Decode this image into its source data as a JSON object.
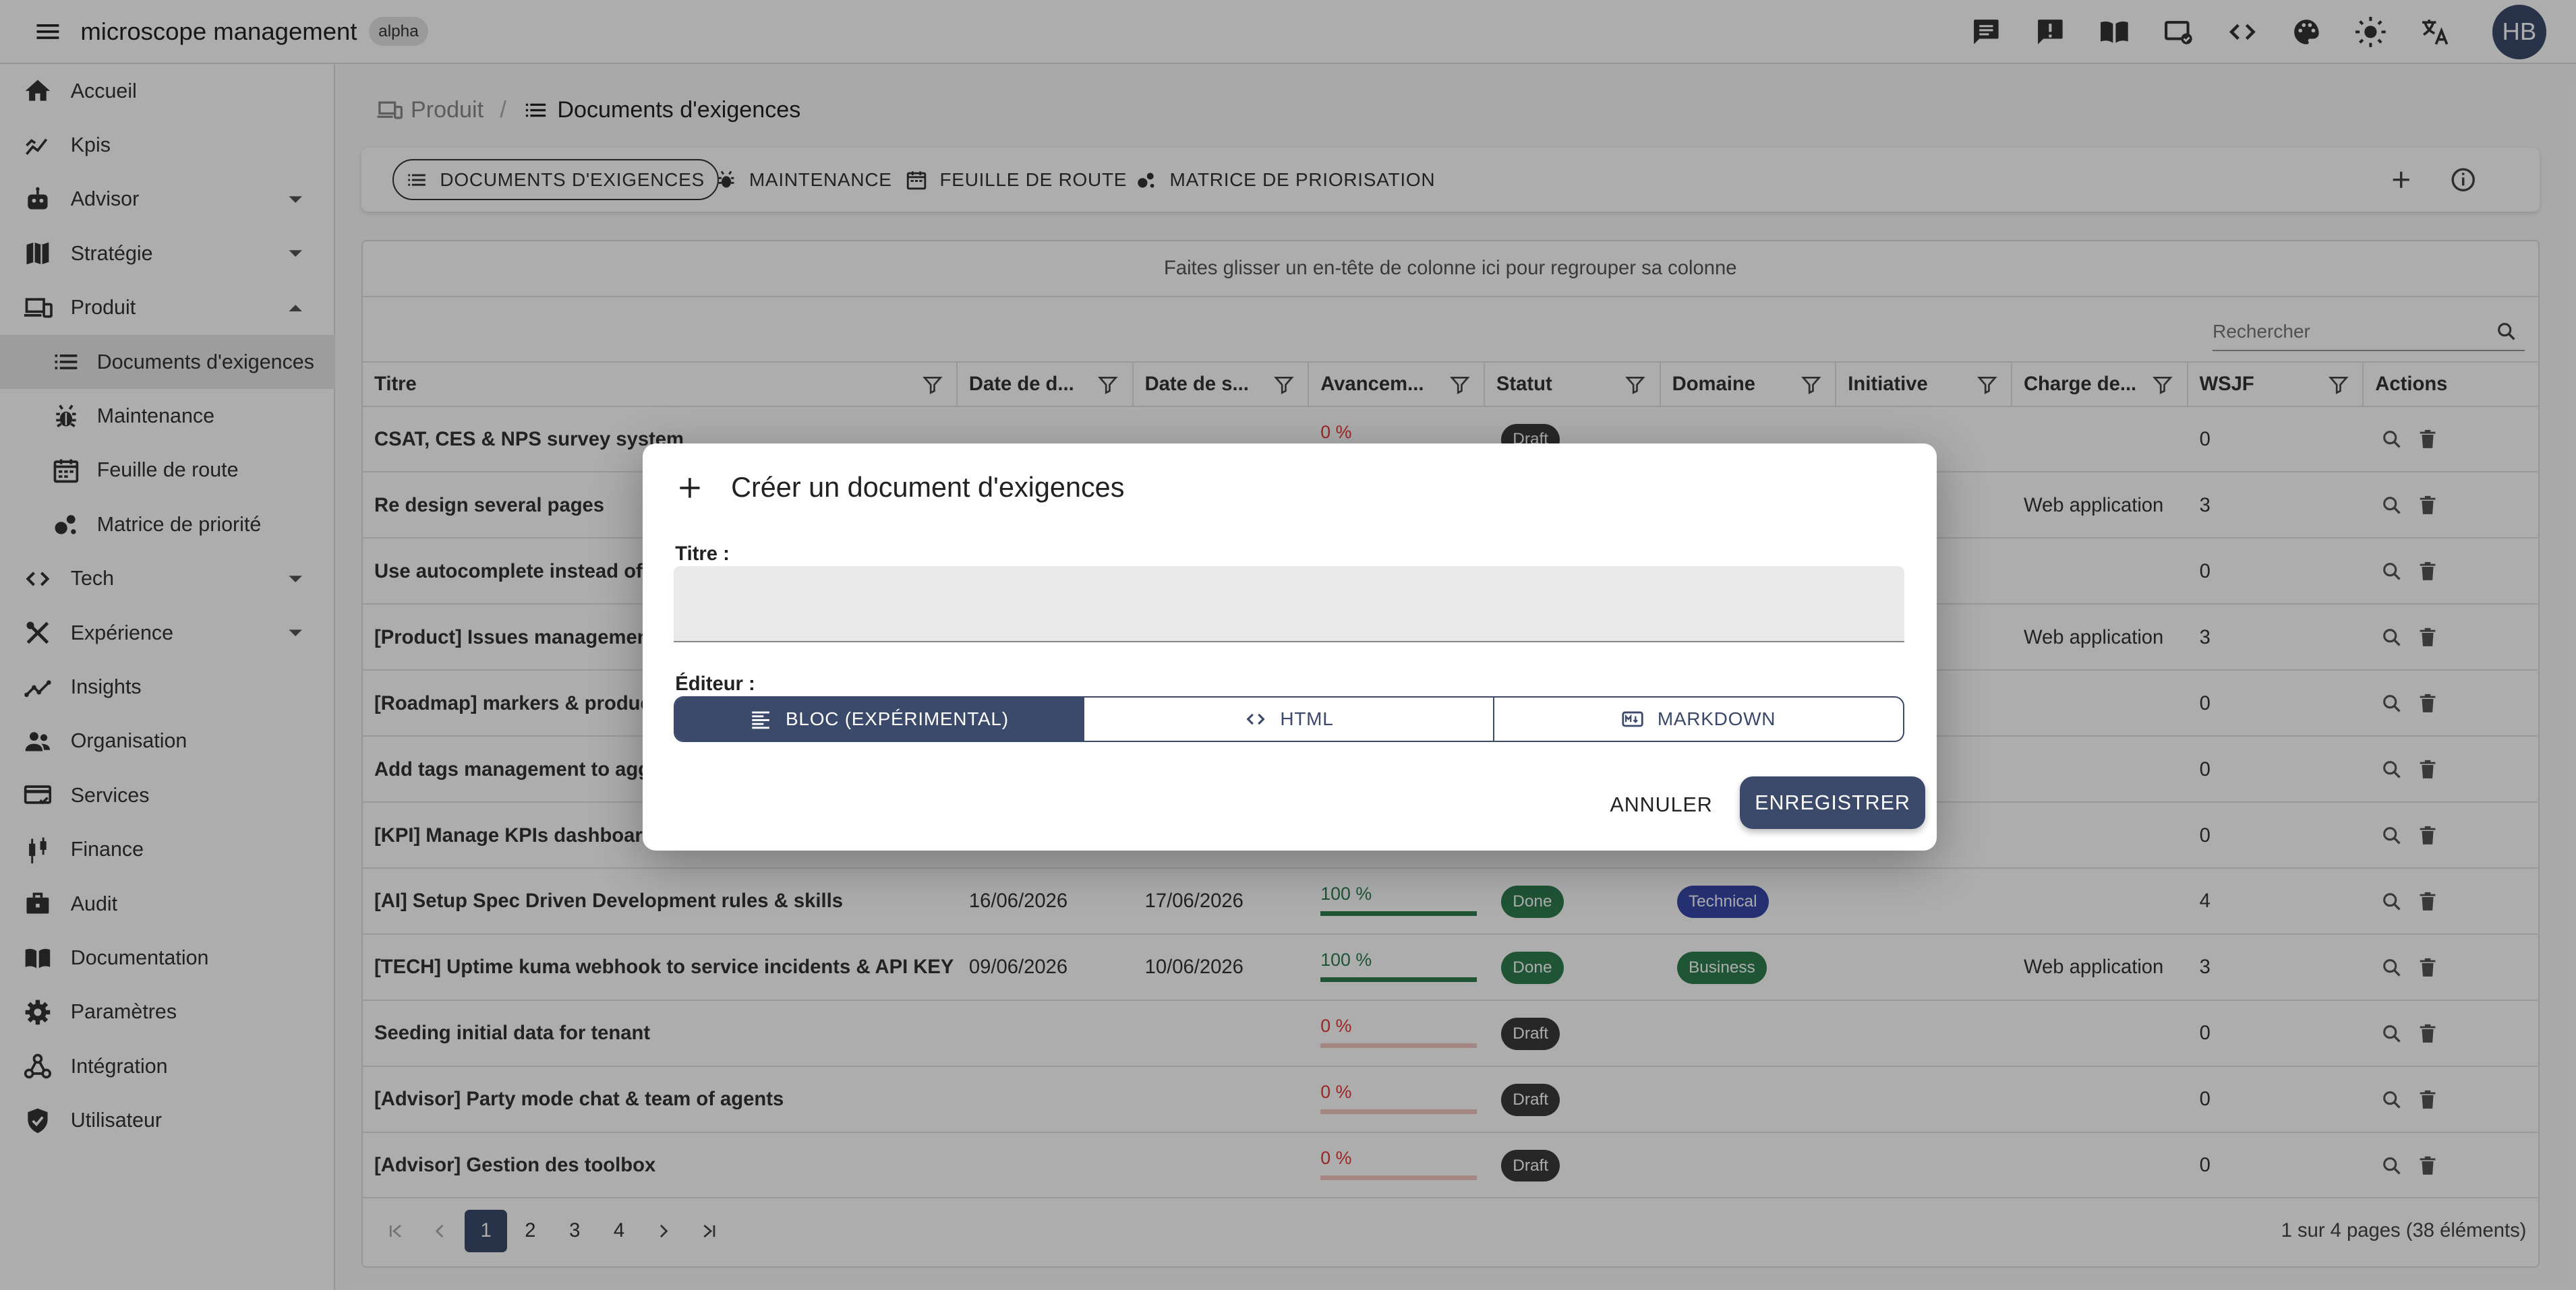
{
  "app": {
    "title": "microscope management",
    "badge": "alpha",
    "avatar": "HB"
  },
  "topbar_icons": [
    "feedback-icon",
    "report-icon",
    "book-icon",
    "screen-check-icon",
    "code-icon",
    "palette-icon",
    "brightness-icon",
    "translate-icon"
  ],
  "sidebar": {
    "items": [
      {
        "label": "Accueil",
        "icon": "home-icon"
      },
      {
        "label": "Kpis",
        "icon": "kpi-chart-icon"
      },
      {
        "label": "Advisor",
        "icon": "robot-icon",
        "expandable": true
      },
      {
        "label": "Stratégie",
        "icon": "map-icon",
        "expandable": true
      },
      {
        "label": "Produit",
        "icon": "devices-icon",
        "expandable": true,
        "expanded": true
      },
      {
        "label": "Documents d'exigences",
        "icon": "list-icon",
        "sub": true,
        "active": true
      },
      {
        "label": "Maintenance",
        "icon": "bug-icon",
        "sub": true
      },
      {
        "label": "Feuille de route",
        "icon": "calendar-icon",
        "sub": true
      },
      {
        "label": "Matrice de priorité",
        "icon": "bubble-chart-icon",
        "sub": true
      },
      {
        "label": "Tech",
        "icon": "code-icon",
        "expandable": true
      },
      {
        "label": "Expérience",
        "icon": "design-tools-icon",
        "expandable": true
      },
      {
        "label": "Insights",
        "icon": "insights-icon"
      },
      {
        "label": "Organisation",
        "icon": "people-icon"
      },
      {
        "label": "Services",
        "icon": "services-icon"
      },
      {
        "label": "Finance",
        "icon": "candlestick-icon"
      },
      {
        "label": "Audit",
        "icon": "briefcase-icon"
      },
      {
        "label": "Documentation",
        "icon": "book-icon"
      },
      {
        "label": "Paramètres",
        "icon": "gear-icon"
      },
      {
        "label": "Intégration",
        "icon": "webhook-icon"
      },
      {
        "label": "Utilisateur",
        "icon": "shield-check-icon"
      }
    ]
  },
  "breadcrumb": {
    "parent": "Produit",
    "current": "Documents d'exigences"
  },
  "tabs": [
    {
      "label": "DOCUMENTS D'EXIGENCES",
      "icon": "list-icon",
      "active": true
    },
    {
      "label": "MAINTENANCE",
      "icon": "bug-icon"
    },
    {
      "label": "FEUILLE DE ROUTE",
      "icon": "calendar-icon"
    },
    {
      "label": "MATRICE DE PRIORISATION",
      "icon": "bubble-chart-icon"
    }
  ],
  "grid": {
    "group_hint": "Faites glisser un en-tête de colonne ici pour regrouper sa colonne",
    "search_placeholder": "Rechercher",
    "columns": [
      "Titre",
      "Date de d...",
      "Date de s...",
      "Avancem...",
      "Statut",
      "Domaine",
      "Initiative",
      "Charge de...",
      "WSJF",
      "Actions"
    ],
    "rows": [
      {
        "title": "CSAT, CES & NPS survey system",
        "start": "",
        "end": "",
        "progress": "0 %",
        "progress_value": 0,
        "status": "Draft",
        "domain": "",
        "initiative": "",
        "charge": "",
        "wsjf": "0"
      },
      {
        "title": "Re design several pages",
        "start": "",
        "end": "",
        "progress": "",
        "progress_value": 0,
        "status": "",
        "domain": "",
        "initiative": "",
        "charge": "Web application",
        "wsjf": "3"
      },
      {
        "title": "Use autocomplete instead of se",
        "start": "",
        "end": "",
        "progress": "",
        "progress_value": 0,
        "status": "",
        "domain": "",
        "initiative": "",
        "charge": "",
        "wsjf": "0"
      },
      {
        "title": "[Product] Issues management",
        "start": "",
        "end": "",
        "progress": "",
        "progress_value": 0,
        "status": "",
        "domain": "",
        "initiative": "",
        "charge": "Web application",
        "wsjf": "3"
      },
      {
        "title": "[Roadmap] markers & product c",
        "start": "",
        "end": "",
        "progress": "",
        "progress_value": 0,
        "status": "",
        "domain": "",
        "initiative": "",
        "charge": "",
        "wsjf": "0"
      },
      {
        "title": "Add tags management to aggre",
        "start": "",
        "end": "",
        "progress": "",
        "progress_value": 0,
        "status": "",
        "domain": "",
        "initiative": "",
        "charge": "",
        "wsjf": "0"
      },
      {
        "title": "[KPI] Manage KPIs dashboards",
        "start": "",
        "end": "",
        "progress": "",
        "progress_value": 0,
        "status": "",
        "domain": "",
        "initiative": "",
        "charge": "",
        "wsjf": "0"
      },
      {
        "title": "[AI] Setup Spec Driven Development rules & skills",
        "start": "16/06/2026",
        "end": "17/06/2026",
        "progress": "100 %",
        "progress_value": 100,
        "status": "Done",
        "domain": "Technical",
        "initiative": "",
        "charge": "",
        "wsjf": "4"
      },
      {
        "title": "[TECH] Uptime kuma webhook to service incidents & API KEY",
        "start": "09/06/2026",
        "end": "10/06/2026",
        "progress": "100 %",
        "progress_value": 100,
        "status": "Done",
        "domain": "Business",
        "initiative": "",
        "charge": "Web application",
        "wsjf": "3"
      },
      {
        "title": "Seeding initial data for tenant",
        "start": "",
        "end": "",
        "progress": "0 %",
        "progress_value": 0,
        "status": "Draft",
        "domain": "",
        "initiative": "",
        "charge": "",
        "wsjf": "0"
      },
      {
        "title": "[Advisor] Party mode chat & team of agents",
        "start": "",
        "end": "",
        "progress": "0 %",
        "progress_value": 0,
        "status": "Draft",
        "domain": "",
        "initiative": "",
        "charge": "",
        "wsjf": "0"
      },
      {
        "title": "[Advisor] Gestion des toolbox",
        "start": "",
        "end": "",
        "progress": "0 %",
        "progress_value": 0,
        "status": "Draft",
        "domain": "",
        "initiative": "",
        "charge": "",
        "wsjf": "0"
      }
    ],
    "pages": [
      "1",
      "2",
      "3",
      "4"
    ],
    "current_page": "1",
    "page_info": "1 sur 4 pages (38 éléments)"
  },
  "dialog": {
    "title": "Créer un document d'exigences",
    "title_label": "Titre :",
    "title_value": "",
    "editor_label": "Éditeur :",
    "editor_options": [
      {
        "label": "BLOC (EXPÉRIMENTAL)",
        "icon": "notes-icon",
        "selected": true
      },
      {
        "label": "HTML",
        "icon": "code-icon"
      },
      {
        "label": "MARKDOWN",
        "icon": "markdown-icon"
      }
    ],
    "cancel": "ANNULER",
    "save": "ENREGISTRER"
  },
  "colors": {
    "primary": "#3b4a6b",
    "draft_badge": "#3a3a3a",
    "done_badge": "#2e7d4f",
    "technical_badge": "#3949ab",
    "business_badge": "#2e7d4f",
    "progress_zero": "#e53935",
    "progress_done": "#2e7d4f"
  }
}
